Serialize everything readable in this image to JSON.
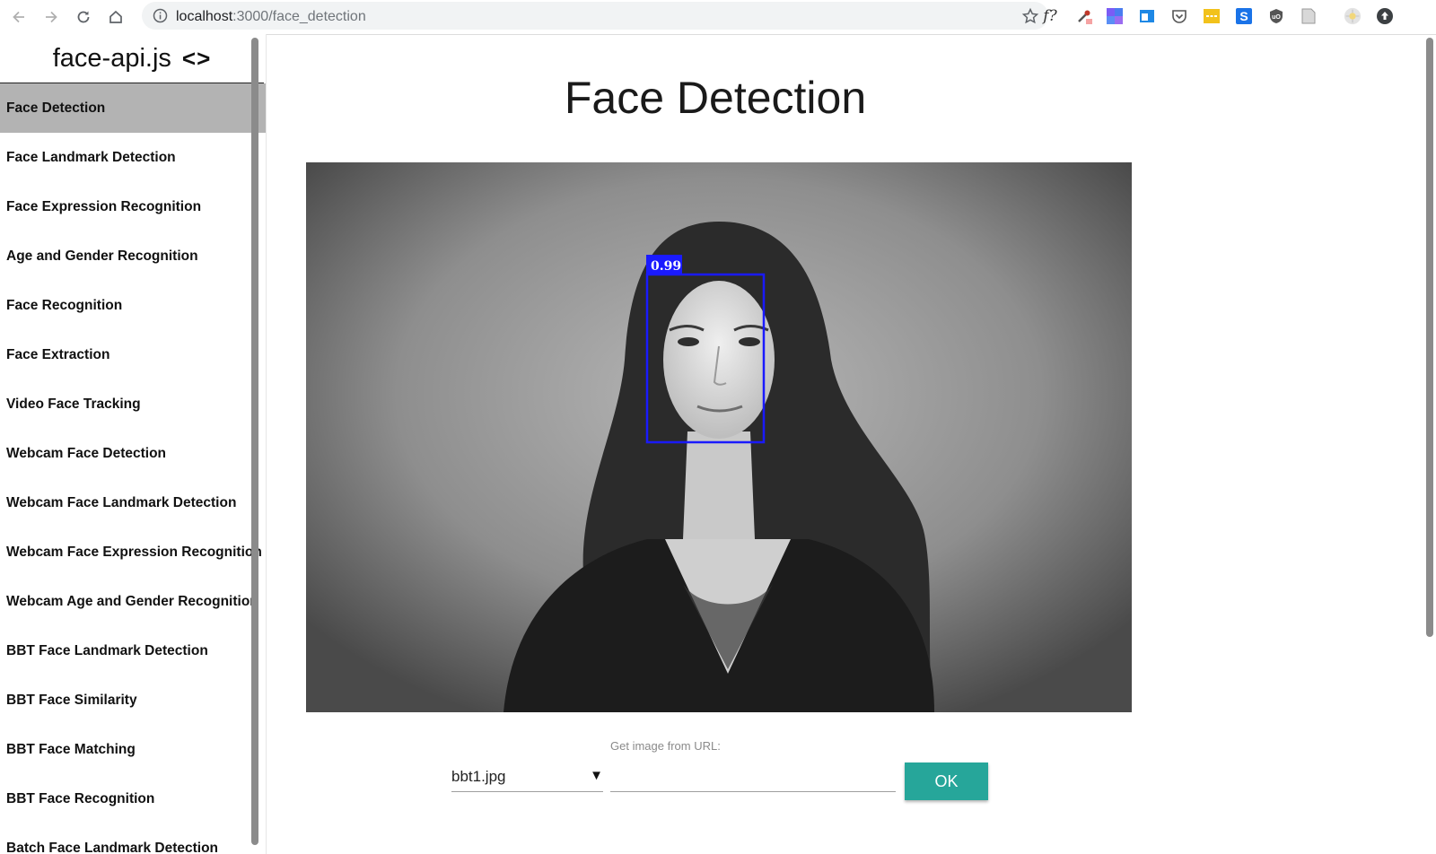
{
  "browser": {
    "url_host": "localhost",
    "url_path": ":3000/face_detection"
  },
  "sidebar": {
    "brand": "face-api.js",
    "brand_code": "<>",
    "items": [
      {
        "label": "Face Detection",
        "active": true
      },
      {
        "label": "Face Landmark Detection"
      },
      {
        "label": "Face Expression Recognition"
      },
      {
        "label": "Age and Gender Recognition"
      },
      {
        "label": "Face Recognition"
      },
      {
        "label": "Face Extraction"
      },
      {
        "label": "Video Face Tracking"
      },
      {
        "label": "Webcam Face Detection"
      },
      {
        "label": "Webcam Face Landmark Detection"
      },
      {
        "label": "Webcam Face Expression Recognition"
      },
      {
        "label": "Webcam Age and Gender Recognition"
      },
      {
        "label": "BBT Face Landmark Detection"
      },
      {
        "label": "BBT Face Similarity"
      },
      {
        "label": "BBT Face Matching"
      },
      {
        "label": "BBT Face Recognition"
      },
      {
        "label": "Batch Face Landmark Detection"
      }
    ]
  },
  "main": {
    "title": "Face Detection",
    "detection_score": "0.99",
    "url_label": "Get image from URL:",
    "image_select_value": "bbt1.jpg",
    "select_arrow": "▼",
    "url_value": "",
    "ok_label": "OK"
  },
  "colors": {
    "active_nav": "#b3b3b3",
    "ok_button": "#26a69a",
    "detection_box": "#1a1aff"
  }
}
